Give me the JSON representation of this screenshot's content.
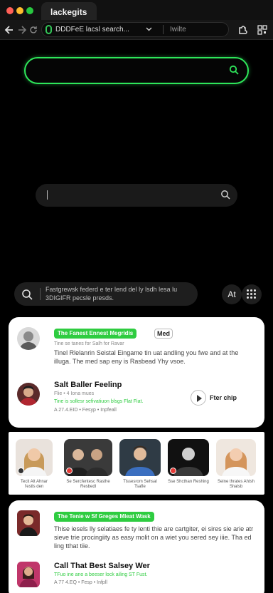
{
  "browser": {
    "tab_title": "lackegits",
    "url": "DDDFeE lacsl search...",
    "omnibox_right": "Iwilte",
    "colors": {
      "secure": "#34c759",
      "accent_green": "#2ee65a"
    }
  },
  "search": {
    "pill_text": "Fastgrewsk federd e ter lend del ly lsdh lesa lu 3DIGIFR pecsle presds."
  },
  "controls": {
    "translate_label": "At",
    "apps_icon": "grid-dots-icon"
  },
  "card1": {
    "item1": {
      "tag": "The Fanest Ennest Megridis",
      "tag_extra": "Med",
      "sub": "Tine se tanes for Salh for Ravar",
      "body": "Tinel Rlelanrin Seistal Eingame tin uat andling you fwe and at the illuga. The med sap eny is Rasbead Yhy vsoe."
    },
    "item2": {
      "title": "Salt Baller Feelinp",
      "rating": "Flie • 4 Iona mues",
      "sub": "Tine is sollesr sefivatiuon blsgs Flat Fiat.",
      "meta": "A 27.4.EID • Fesyp • Inpfeall",
      "filter_label": "Fter chip"
    }
  },
  "carousel": {
    "people": [
      {
        "name": "Tecit Alt Ahnar l'estls den"
      },
      {
        "name": "Se Sercfentesc Rasthe Resbedl"
      },
      {
        "name": "Tissesrom Sehsal Tsafle"
      },
      {
        "name": "Sse Shcthan Reshing"
      },
      {
        "name": "Seine thrates Ahtsh Shalsb"
      }
    ]
  },
  "card3": {
    "item1": {
      "tag": "The Tenie w Sf Greges Mleat Wask",
      "body": "Thise iesels lly selatiaes fe ty lenti thie are cartgiter, ei sires sie arie atr sieve trie procingiity as easy molit on a wiet you sered sey iiie. Tha ed ling tthat tiie."
    },
    "item2": {
      "title": "Call That Best Salsey Wer",
      "sub": "TFuo ine ano a beeser lock ailing ST Fust.",
      "meta": "A 77 4.EQ • Fesp • Infpll"
    }
  }
}
